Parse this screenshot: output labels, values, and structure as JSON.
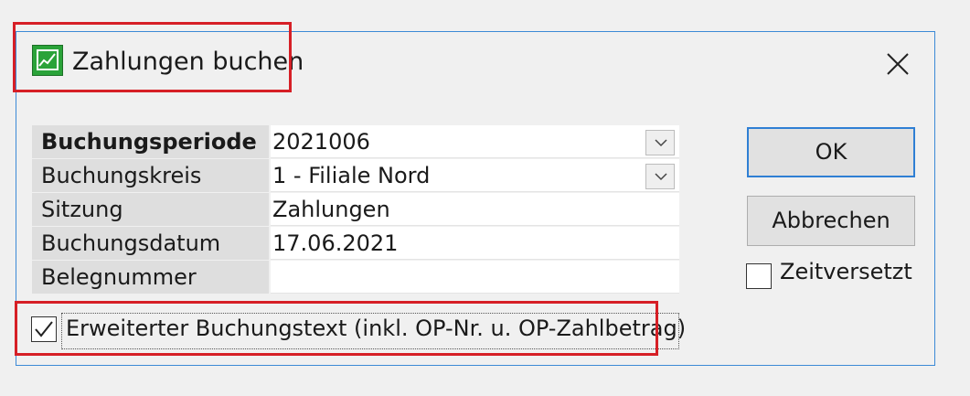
{
  "window": {
    "title": "Zahlungen buchen"
  },
  "fields": [
    {
      "label": "Buchungsperiode",
      "value": "2021006",
      "has_dropdown": true,
      "bold": true
    },
    {
      "label": "Buchungskreis",
      "value": "1 - Filiale Nord",
      "has_dropdown": true,
      "bold": false
    },
    {
      "label": "Sitzung",
      "value": "Zahlungen",
      "has_dropdown": false,
      "bold": false
    },
    {
      "label": "Buchungsdatum",
      "value": "17.06.2021",
      "has_dropdown": false,
      "bold": false
    },
    {
      "label": "Belegnummer",
      "value": "",
      "has_dropdown": false,
      "bold": false
    }
  ],
  "buttons": {
    "ok": "OK",
    "cancel": "Abbrechen"
  },
  "zeitversetzt": {
    "label": "Zeitversetzt",
    "checked": false
  },
  "extended_text": {
    "label": "Erweiterter Buchungstext (inkl. OP-Nr. u. OP-Zahlbetrag)",
    "checked": true
  },
  "colors": {
    "highlight": "#d61f26",
    "accent": "#2f7fd4",
    "icon": "#2aa339"
  },
  "icons": {
    "title": "chart-icon",
    "close": "close-icon",
    "dropdown": "chevron-down-icon"
  }
}
